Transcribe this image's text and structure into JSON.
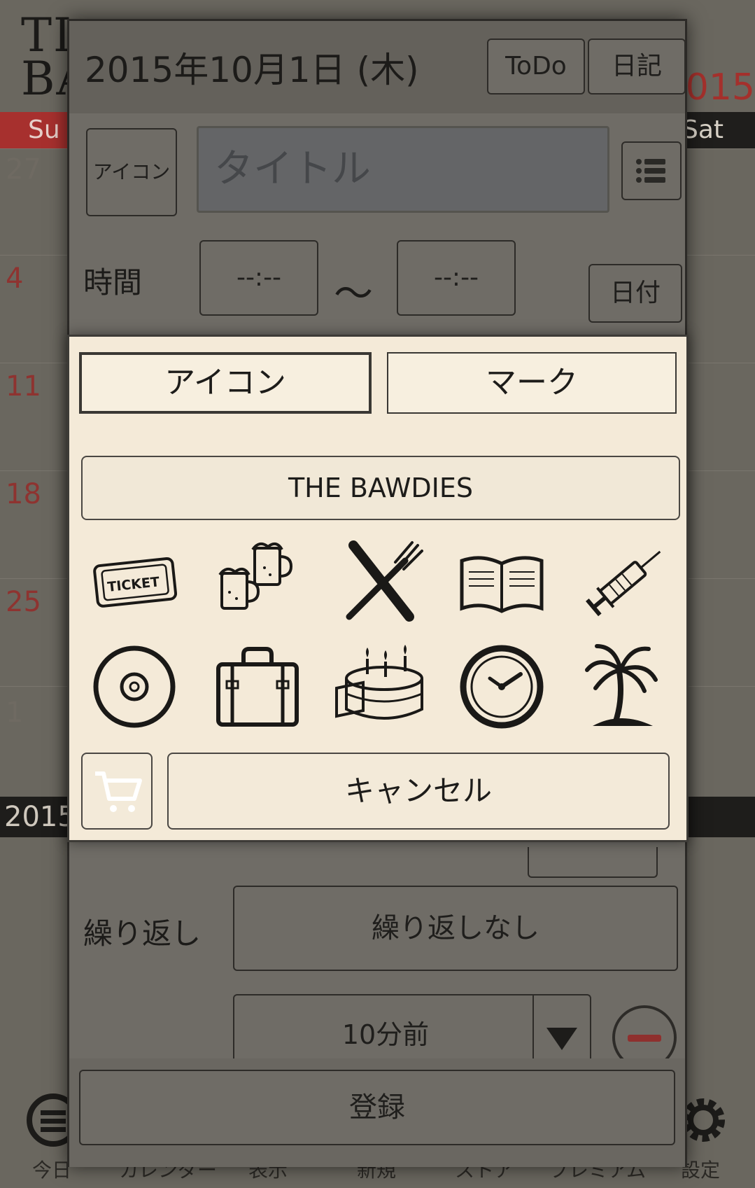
{
  "calendar": {
    "logo_line1": "TI",
    "logo_line2": "BA",
    "year_label": "015",
    "sun_label": "Su",
    "sat_label": "Sat",
    "week_numbers": [
      "27",
      "4",
      "11",
      "18",
      "25",
      "1"
    ],
    "bottom_bar_label": "2015"
  },
  "tabbar": {
    "items": [
      {
        "label": "今日",
        "icon": "today-icon"
      },
      {
        "label": "カレンダー",
        "icon": "calendar-icon"
      },
      {
        "label": "表示",
        "icon": "view-icon"
      },
      {
        "label": "新規",
        "icon": "new-icon"
      },
      {
        "label": "ストア",
        "icon": "store-icon"
      },
      {
        "label": "プレミアム",
        "icon": "premium-icon"
      },
      {
        "label": "設定",
        "icon": "gear-icon"
      }
    ]
  },
  "editor": {
    "date_title": "2015年10月1日 (木)",
    "todo_label": "ToDo",
    "diary_label": "日記",
    "icon_button_label": "アイコン",
    "title_placeholder": "タイトル",
    "time_label": "時間",
    "start_time": "--:--",
    "tilde": "〜",
    "end_time": "--:--",
    "date_button_label": "日付",
    "repeat_label": "繰り返し",
    "repeat_value": "繰り返しなし",
    "reminder_value": "10分前",
    "register_label": "登録"
  },
  "icon_picker": {
    "tab_icon_label": "アイコン",
    "tab_mark_label": "マーク",
    "icon_set_label": "THE BAWDIES",
    "ticket_text": "TICKET",
    "icons": [
      "ticket-icon",
      "beer-icon",
      "knife-fork-icon",
      "book-icon",
      "syringe-icon",
      "disc-icon",
      "suitcase-icon",
      "birthday-cake-icon",
      "clock-icon",
      "palm-tree-icon"
    ],
    "cancel_label": "キャンセル"
  },
  "colors": {
    "accent_red": "#a7302e",
    "dialog_bg": "#f4ead8",
    "dim_bg": "#6f6c66"
  }
}
